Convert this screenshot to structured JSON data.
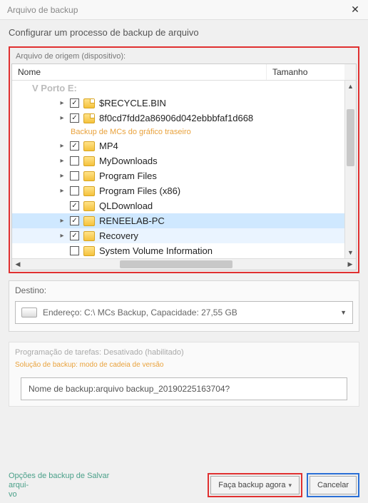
{
  "window": {
    "title": "Arquivo de backup",
    "subtitle": "Configurar um processo de backup de arquivo"
  },
  "source": {
    "group_label": "Arquivo de origem (dispositivo):",
    "columns": {
      "name": "Nome",
      "size": "Tamanho"
    },
    "drive_label": "V Porto E:",
    "sub_heading": "Backup de MCs do gráfico traseiro",
    "items": [
      {
        "label": "$RECYCLE.BIN",
        "checked": true,
        "exp": true,
        "indent": 64
      },
      {
        "label": "8f0cd7fdd2a86906d042ebbbfaf1d668",
        "checked": true,
        "exp": true,
        "indent": 64
      },
      {
        "label": "MP4",
        "checked": true,
        "exp": true,
        "indent": 64
      },
      {
        "label": "MyDownloads",
        "checked": false,
        "exp": true,
        "indent": 64
      },
      {
        "label": "Program Files",
        "checked": false,
        "exp": true,
        "indent": 64
      },
      {
        "label": "Program Files (x86)",
        "checked": false,
        "exp": true,
        "indent": 64
      },
      {
        "label": "QLDownload",
        "checked": true,
        "exp": false,
        "indent": 64
      },
      {
        "label": "RENEELAB-PC",
        "checked": true,
        "exp": true,
        "indent": 64,
        "selected": true
      },
      {
        "label": "Recovery",
        "checked": true,
        "exp": true,
        "indent": 64,
        "selected2": true
      },
      {
        "label": "System Volume Information",
        "checked": false,
        "exp": false,
        "indent": 64
      }
    ]
  },
  "destination": {
    "label": "Destino:",
    "value": "Endereço: C:\\ MCs Backup, Capacidade: 27,55 GB"
  },
  "schedule": {
    "label": "Programação de tarefas: Desativado (habilitado)",
    "solution": "Solução de backup: modo de cadeia de versão"
  },
  "backup_name": {
    "prefix": "Nome de backup: ",
    "value": "arquivo backup_20190225163704?"
  },
  "footer": {
    "options": "Opções de backup de Salvar arqui-\nvo",
    "primary": "Faça backup agora",
    "cancel": "Cancelar"
  }
}
